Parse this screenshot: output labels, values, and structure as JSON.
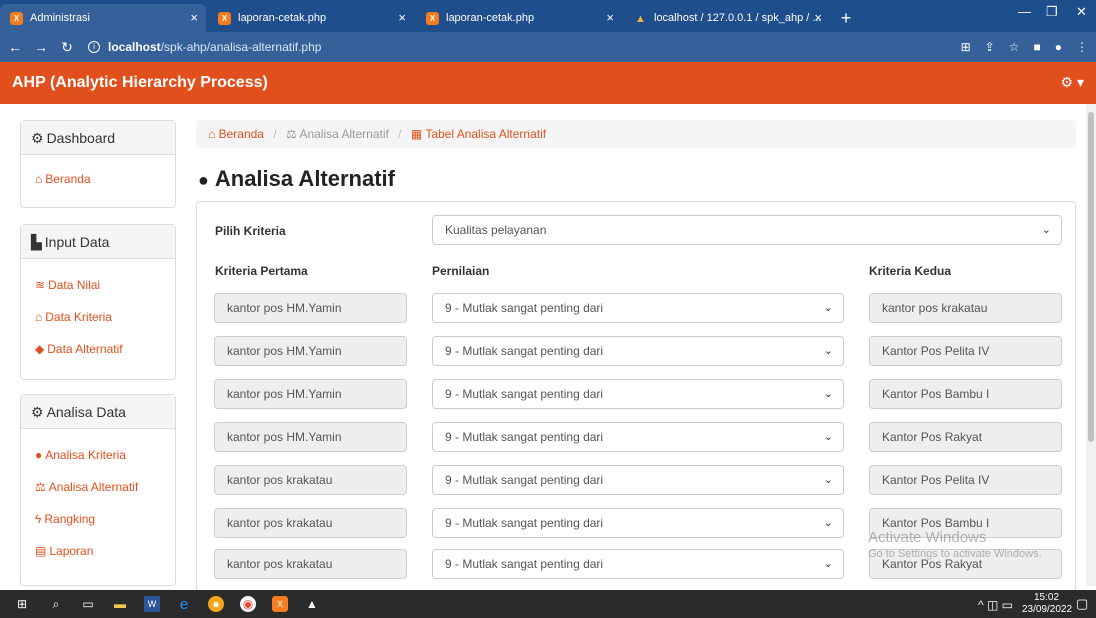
{
  "browser": {
    "tabs": [
      {
        "title": "Administrasi",
        "active": true
      },
      {
        "title": "laporan-cetak.php",
        "active": false
      },
      {
        "title": "laporan-cetak.php",
        "active": false
      },
      {
        "title": "localhost / 127.0.0.1 / spk_ahp / ...",
        "active": false
      }
    ],
    "url_host": "localhost",
    "url_path": "/spk-ahp/analisa-alternatif.php"
  },
  "app": {
    "brand": "AHP (Analytic Hierarchy Process)",
    "accent": "#e1501c"
  },
  "sidebar": {
    "dashboard": {
      "title": "Dashboard",
      "items": [
        {
          "label": "Beranda",
          "icon": "home-icon"
        }
      ]
    },
    "input": {
      "title": "Input Data",
      "items": [
        {
          "label": "Data Nilai",
          "icon": "graduation-icon"
        },
        {
          "label": "Data Kriteria",
          "icon": "bank-icon"
        },
        {
          "label": "Data Alternatif",
          "icon": "tag-icon"
        }
      ]
    },
    "analisa": {
      "title": "Analisa Data",
      "items": [
        {
          "label": "Analisa Kriteria",
          "icon": "bomb-icon"
        },
        {
          "label": "Analisa Alternatif",
          "icon": "scale-icon"
        },
        {
          "label": "Rangking",
          "icon": "flash-icon"
        },
        {
          "label": "Laporan",
          "icon": "document-icon"
        }
      ]
    }
  },
  "breadcrumb": [
    "Beranda",
    "Analisa Alternatif",
    "Tabel Analisa Alternatif"
  ],
  "page_title": "Analisa Alternatif",
  "form": {
    "pilih_label": "Pilih Kriteria",
    "pilih_value": "Kualitas pelayanan",
    "col_pertama": "Kriteria Pertama",
    "col_penilaian": "Pernilaian",
    "col_kedua": "Kriteria Kedua",
    "rows": [
      {
        "pertama": "kantor pos HM.Yamin",
        "nilai": "9 - Mutlak sangat penting dari",
        "kedua": "kantor pos krakatau"
      },
      {
        "pertama": "kantor pos HM.Yamin",
        "nilai": "9 - Mutlak sangat penting dari",
        "kedua": "Kantor Pos Pelita IV"
      },
      {
        "pertama": "kantor pos HM.Yamin",
        "nilai": "9 - Mutlak sangat penting dari",
        "kedua": "Kantor Pos Bambu I"
      },
      {
        "pertama": "kantor pos HM.Yamin",
        "nilai": "9 - Mutlak sangat penting dari",
        "kedua": "Kantor Pos  Rakyat"
      },
      {
        "pertama": "kantor pos krakatau",
        "nilai": "9 - Mutlak sangat penting dari",
        "kedua": "Kantor Pos Pelita IV"
      },
      {
        "pertama": "kantor pos krakatau",
        "nilai": "9 - Mutlak sangat penting dari",
        "kedua": "Kantor Pos Bambu I"
      },
      {
        "pertama": "kantor pos krakatau",
        "nilai": "9 - Mutlak sangat penting dari",
        "kedua": "Kantor Pos  Rakyat"
      }
    ]
  },
  "watermark": {
    "line1": "Activate Windows",
    "line2": "Go to Settings to activate Windows."
  },
  "taskbar": {
    "time": "15:02",
    "date": "23/09/2022"
  }
}
